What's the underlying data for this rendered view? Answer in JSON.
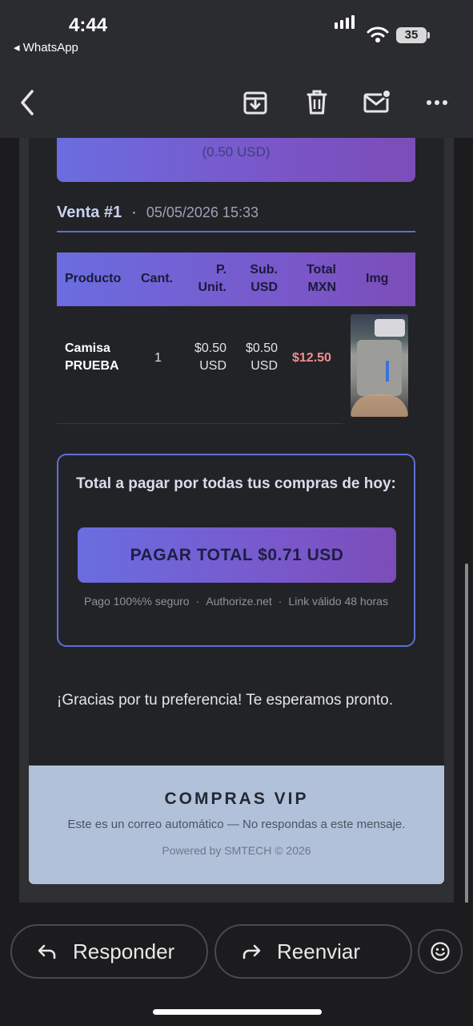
{
  "status_bar": {
    "time": "4:44",
    "back_app": "WhatsApp",
    "battery": "35"
  },
  "email": {
    "top_banner_usd": "(0.50 USD)",
    "sale": {
      "title": "Venta #1",
      "separator": "·",
      "datetime": "05/05/2026 15:33"
    },
    "table": {
      "headers": [
        "Producto",
        "Cant.",
        "P. Unit.",
        "Sub. USD",
        "Total MXN",
        "Img"
      ],
      "rows": [
        {
          "product": "Camisa PRUEBA",
          "qty": "1",
          "unit": "$0.50 USD",
          "sub": "$0.50 USD",
          "total": "$12.50"
        }
      ]
    },
    "payment": {
      "title": "Total a pagar por todas tus compras de hoy:",
      "button": "PAGAR TOTAL $0.71 USD",
      "note_1": "Pago 100%% seguro",
      "note_2": "Authorize.net",
      "note_3": "Link válido 48 horas",
      "note_sep": "·"
    },
    "thanks": "¡Gracias por tu preferencia! Te esperamos pronto.",
    "footer": {
      "brand": "COMPRAS VIP",
      "note": "Este es un correo automático — No respondas a este mensaje.",
      "powered": "Powered by SMTECH © 2026"
    }
  },
  "bottom_actions": {
    "reply": "Responder",
    "forward": "Reenviar"
  },
  "colors": {
    "accent_start": "#6a6de0",
    "accent_end": "#7b4db8",
    "price_red": "#f08f8f",
    "border_blue": "#5d6fd9",
    "footer_bg": "#b1c1d9"
  },
  "icons": [
    "back-chevron-icon",
    "archive-icon",
    "trash-icon",
    "mark-unread-icon",
    "more-icon",
    "reply-icon",
    "forward-icon",
    "emoji-icon",
    "signal-icon",
    "wifi-icon",
    "battery-icon"
  ]
}
